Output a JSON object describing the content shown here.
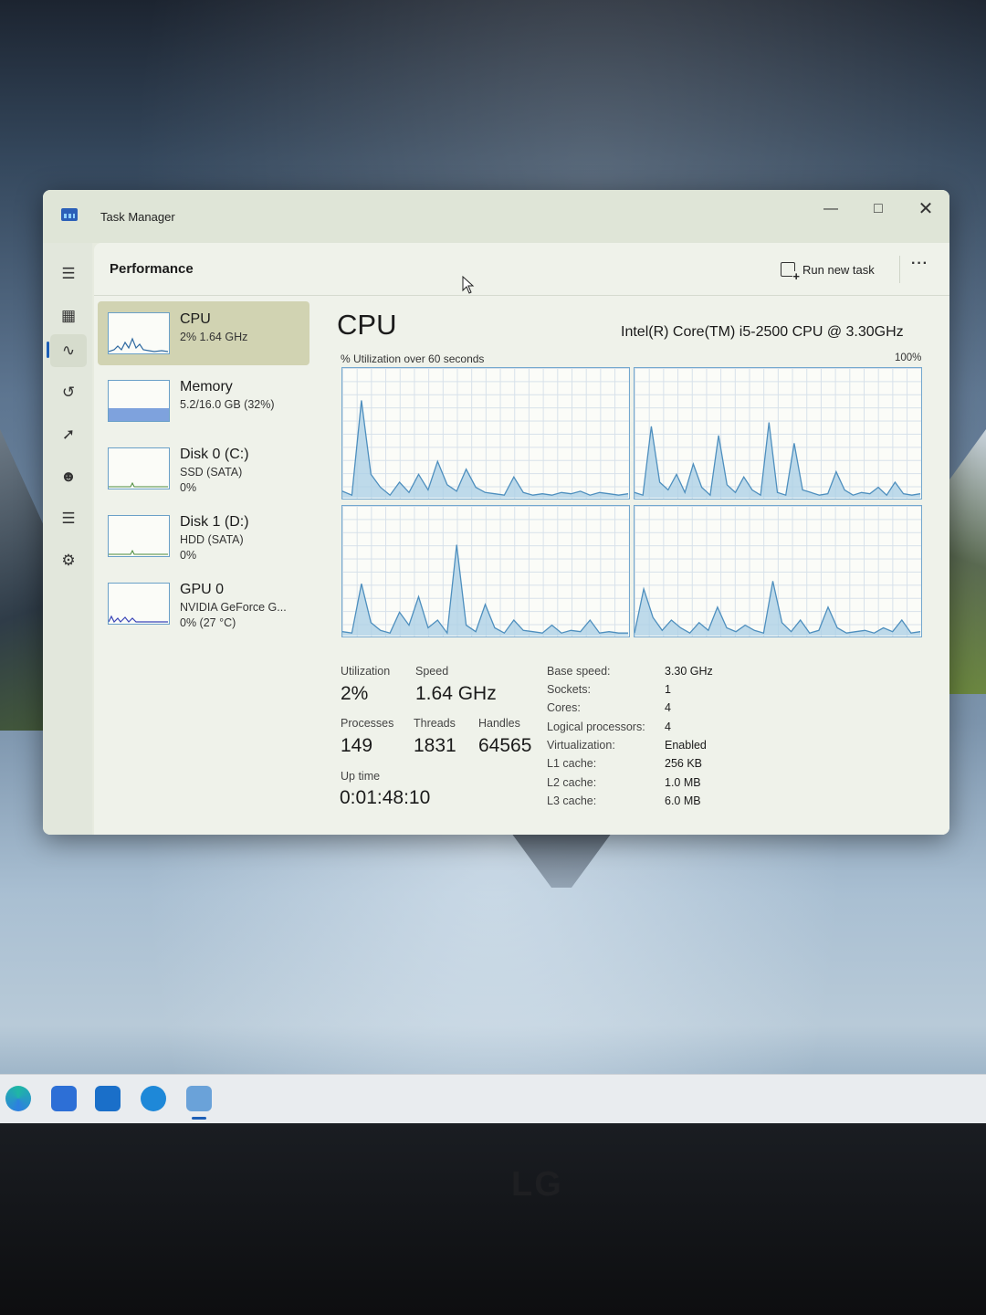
{
  "window": {
    "title": "Task Manager"
  },
  "header": {
    "page_title": "Performance",
    "run_task_label": "Run new task",
    "more_label": "···"
  },
  "resources": [
    {
      "name": "CPU",
      "sub1": "2%  1.64 GHz",
      "sub2": "",
      "selected": true
    },
    {
      "name": "Memory",
      "sub1": "5.2/16.0 GB (32%)",
      "sub2": ""
    },
    {
      "name": "Disk 0 (C:)",
      "sub1": "SSD (SATA)",
      "sub2": "0%"
    },
    {
      "name": "Disk 1 (D:)",
      "sub1": "HDD (SATA)",
      "sub2": "0%"
    },
    {
      "name": "GPU 0",
      "sub1": "NVIDIA GeForce G...",
      "sub2": "0% (27 °C)"
    }
  ],
  "memory_usage_fraction": 0.32,
  "cpu": {
    "title": "CPU",
    "model": "Intel(R) Core(TM) i5-2500 CPU @ 3.30GHz",
    "graph_label": "% Utilization over 60 seconds",
    "graph_max": "100%",
    "stats": {
      "utilization_label": "Utilization",
      "utilization": "2%",
      "speed_label": "Speed",
      "speed": "1.64 GHz",
      "processes_label": "Processes",
      "processes": "149",
      "threads_label": "Threads",
      "threads": "1831",
      "handles_label": "Handles",
      "handles": "64565",
      "uptime_label": "Up time",
      "uptime": "0:01:48:10"
    },
    "specs": [
      {
        "label": "Base speed:",
        "value": "3.30 GHz"
      },
      {
        "label": "Sockets:",
        "value": "1"
      },
      {
        "label": "Cores:",
        "value": "4"
      },
      {
        "label": "Logical processors:",
        "value": "4"
      },
      {
        "label": "Virtualization:",
        "value": "Enabled"
      },
      {
        "label": "L1 cache:",
        "value": "256 KB"
      },
      {
        "label": "L2 cache:",
        "value": "1.0 MB"
      },
      {
        "label": "L3 cache:",
        "value": "6.0 MB"
      }
    ]
  },
  "chart_data": {
    "type": "area",
    "x_range": [
      0,
      60
    ],
    "ylim": [
      0,
      100
    ],
    "series": [
      {
        "values": [
          5,
          2,
          75,
          18,
          8,
          2,
          12,
          4,
          18,
          6,
          28,
          10,
          5,
          22,
          8,
          4,
          3,
          2,
          16,
          4,
          2,
          3,
          2,
          4,
          3,
          5,
          2,
          4,
          3,
          2,
          3
        ]
      },
      {
        "values": [
          4,
          2,
          55,
          12,
          6,
          18,
          4,
          26,
          8,
          2,
          48,
          10,
          4,
          16,
          6,
          2,
          58,
          4,
          2,
          42,
          6,
          4,
          2,
          3,
          20,
          6,
          2,
          4,
          3,
          8,
          2,
          12,
          3,
          2,
          3
        ]
      },
      {
        "values": [
          3,
          2,
          40,
          10,
          4,
          2,
          18,
          8,
          30,
          6,
          12,
          2,
          70,
          8,
          3,
          24,
          6,
          2,
          12,
          4,
          3,
          2,
          8,
          2,
          4,
          3,
          12,
          2,
          3,
          2,
          2
        ]
      },
      {
        "values": [
          2,
          36,
          14,
          4,
          12,
          6,
          2,
          10,
          4,
          22,
          6,
          3,
          8,
          4,
          2,
          42,
          10,
          3,
          12,
          2,
          4,
          22,
          6,
          2,
          3,
          4,
          2,
          6,
          3,
          12,
          2,
          3
        ]
      }
    ]
  },
  "colors": {
    "graph_line": "#4e8fbe",
    "graph_fill": "#a9cfe6",
    "selected_item": "#d1d3b2"
  },
  "icons": [
    "hamburger-icon",
    "processes-icon",
    "performance-icon",
    "history-icon",
    "startup-icon",
    "users-icon",
    "details-icon",
    "services-icon",
    "settings-icon"
  ]
}
